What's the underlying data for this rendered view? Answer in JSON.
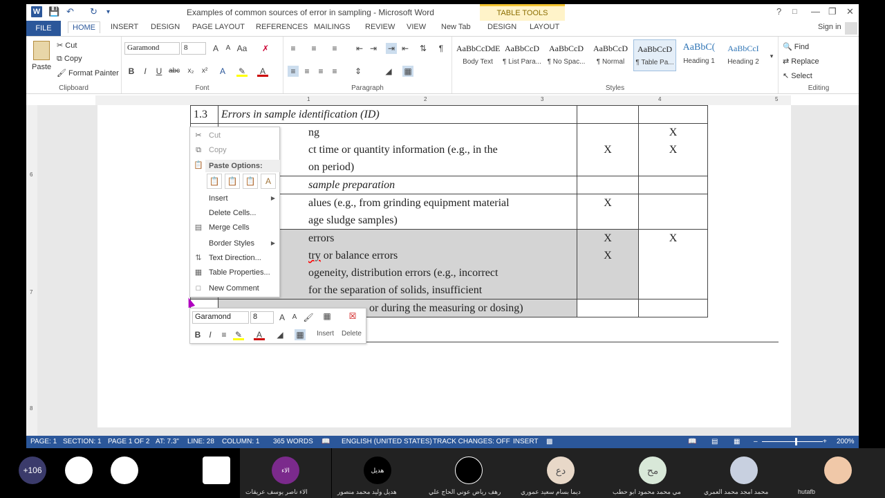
{
  "window": {
    "title": "Examples of common sources of error in sampling - Microsoft Word",
    "table_tools": "TABLE TOOLS",
    "help": "?",
    "minimize": "—",
    "restore": "❐",
    "close": "✕"
  },
  "tabs": [
    "FILE",
    "HOME",
    "INSERT",
    "DESIGN",
    "PAGE LAYOUT",
    "REFERENCES",
    "MAILINGS",
    "REVIEW",
    "VIEW",
    "New Tab",
    "DESIGN",
    "LAYOUT"
  ],
  "signin": "Sign in",
  "ribbon": {
    "clipboard": {
      "paste": "Paste",
      "cut": "Cut",
      "copy": "Copy",
      "format_painter": "Format Painter",
      "label": "Clipboard"
    },
    "font": {
      "name": "Garamond",
      "size": "8",
      "label": "Font"
    },
    "paragraph": {
      "label": "Paragraph"
    },
    "styles": {
      "label": "Styles",
      "items": [
        {
          "preview": "AaBbCcDdE",
          "name": "Body Text"
        },
        {
          "preview": "AaBbCcD",
          "name": "¶ List Para..."
        },
        {
          "preview": "AaBbCcD",
          "name": "¶ No Spac..."
        },
        {
          "preview": "AaBbCcD",
          "name": "¶ Normal"
        },
        {
          "preview": "AaBbCcD",
          "name": "¶ Table Pa..."
        },
        {
          "preview": "AaBbC(",
          "name": "Heading 1"
        },
        {
          "preview": "AaBbCcI",
          "name": "Heading 2"
        }
      ]
    },
    "editing": {
      "find": "Find",
      "replace": "Replace",
      "select": "Select",
      "label": "Editing"
    }
  },
  "ruler": [
    "1",
    "2",
    "3",
    "4",
    "5"
  ],
  "vruler": [
    "6",
    "7",
    "8"
  ],
  "table": {
    "section_num": "1.3",
    "section_title": "Errors in sample identification (ID)",
    "row1": {
      "line1": "ng",
      "line2": "ct time or quantity information (e.g., in the",
      "line3": "on period)",
      "c1": "X",
      "c2_a": "X",
      "c2_b": "X"
    },
    "row2_title": "sample preparation",
    "row3": {
      "line1": "alues (e.g., from grinding equipment material",
      "line2": "age sludge samples)",
      "c1": "X"
    },
    "row4": {
      "line1": "errors",
      "line2a": "",
      "line2u": "try",
      "line2b": " or balance errors",
      "line3": "ogeneity, distribution errors (e.g., incorrect",
      "line4": "for the separation of solids, insufficient",
      "c1_a": "X",
      "c1_b": "X",
      "c2": "X"
    },
    "row5": {
      "line1": "or during the measuring or dosing)"
    }
  },
  "context_menu": {
    "cut": "Cut",
    "copy": "Copy",
    "paste_options": "Paste Options:",
    "insert": "Insert",
    "delete_cells": "Delete Cells...",
    "merge_cells": "Merge Cells",
    "border_styles": "Border Styles",
    "text_direction": "Text Direction...",
    "table_properties": "Table Properties...",
    "new_comment": "New Comment"
  },
  "mini_toolbar": {
    "font": "Garamond",
    "size": "8",
    "insert": "Insert",
    "delete": "Delete"
  },
  "status": {
    "page": "PAGE: 1",
    "section": "SECTION: 1",
    "page_of": "PAGE 1 OF 2",
    "at": "AT: 7.3\"",
    "line": "LINE: 28",
    "column": "COLUMN: 1",
    "words": "365 WORDS",
    "language": "ENGLISH (UNITED STATES)",
    "track": "TRACK CHANGES: OFF",
    "mode": "INSERT",
    "zoom": "200%"
  },
  "participants": {
    "count": "+106",
    "names": [
      "",
      "الاء ناصر يوسف عريقات",
      "هديل وليد محمد منصور",
      "رهف رياض عوني الحاج علي",
      "ديما بسام سعيد عموري",
      "مي محمد محمود ابو حطب",
      "محمد امجد محمد العمري",
      "hutafb"
    ],
    "avatars": [
      "",
      "",
      "",
      "",
      "",
      "الاء عريقات",
      "هديل منصور",
      "",
      "دع",
      "مح",
      "",
      ""
    ]
  }
}
